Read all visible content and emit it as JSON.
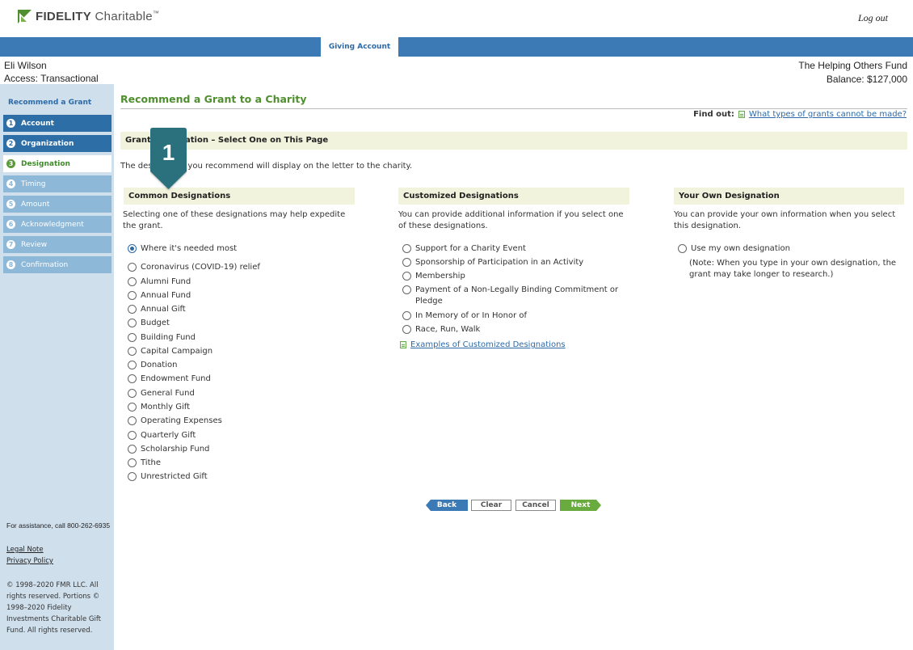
{
  "header": {
    "brand_bold": "FIDELITY",
    "brand_rest": " Charitable",
    "brand_tm": "™",
    "logout": "Log out",
    "tab": "Giving Account"
  },
  "account": {
    "name": "Eli Wilson",
    "access": "Access: Transactional",
    "fund": "The Helping Others Fund",
    "balance": "Balance: $127,000"
  },
  "sidebar": {
    "title": "Recommend a Grant",
    "steps": [
      {
        "num": "1",
        "label": "Account"
      },
      {
        "num": "2",
        "label": "Organization"
      },
      {
        "num": "3",
        "label": "Designation"
      },
      {
        "num": "4",
        "label": "Timing"
      },
      {
        "num": "5",
        "label": "Amount"
      },
      {
        "num": "6",
        "label": "Acknowledgment"
      },
      {
        "num": "7",
        "label": "Review"
      },
      {
        "num": "8",
        "label": "Confirmation"
      }
    ],
    "assist": "For assistance, call 800-262-6935",
    "legal": "Legal Note",
    "privacy": "Privacy Policy",
    "copyright": "© 1998–2020 FMR LLC. All rights reserved. Portions © 1998–2020 Fidelity Investments Charitable Gift Fund. All rights reserved."
  },
  "main": {
    "title": "Recommend a Grant to a Charity",
    "find_out_label": "Find out:",
    "find_out_link": "What types of grants cannot be made?",
    "section_title": "Grant Designation – Select One on This Page",
    "intro": "The designation you recommend will display on the letter to the charity.",
    "callout": "1"
  },
  "common": {
    "heading": "Common Designations",
    "desc": "Selecting one of these designations may help expedite the grant.",
    "options": [
      "Where it's needed most",
      "Coronavirus (COVID-19) relief",
      "Alumni Fund",
      "Annual Fund",
      "Annual Gift",
      "Budget",
      "Building Fund",
      "Capital Campaign",
      "Donation",
      "Endowment Fund",
      "General Fund",
      "Monthly Gift",
      "Operating Expenses",
      "Quarterly Gift",
      "Scholarship Fund",
      "Tithe",
      "Unrestricted Gift"
    ],
    "selected": "Where it's needed most"
  },
  "customized": {
    "heading": "Customized Designations",
    "desc": "You can provide additional information if you select one of these designations.",
    "options": [
      "Support for a Charity Event",
      "Sponsorship of Participation in an Activity",
      "Membership",
      "Payment of a Non-Legally Binding Commitment or Pledge",
      "In Memory of or In Honor of",
      "Race, Run, Walk"
    ],
    "examples_link": "Examples of Customized Designations"
  },
  "own": {
    "heading": "Your Own Designation",
    "desc": "You can provide your own information when you select this designation.",
    "option": "Use my own designation",
    "note": "(Note: When you type in your own designation, the grant may take longer to research.)"
  },
  "buttons": {
    "back": "Back",
    "clear": "Clear",
    "cancel": "Cancel",
    "next": "Next"
  },
  "colors": {
    "nav_blue": "#3c7ab5",
    "sidebar_bg": "#cfdfec",
    "title_green": "#4f8f2f",
    "callout_teal": "#2c6f7d",
    "next_green": "#6aab3f"
  }
}
